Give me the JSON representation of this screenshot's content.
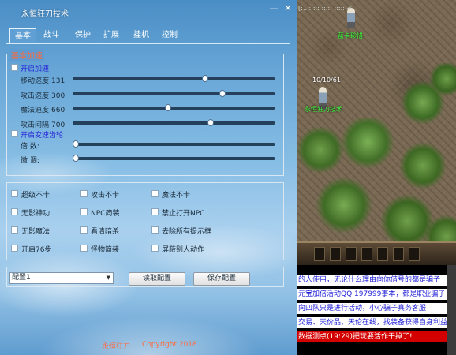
{
  "window": {
    "title": "永恒狂刀技术",
    "minimize_label": "—",
    "close_label": "✕"
  },
  "tabs": [
    {
      "label": "基本",
      "active": true
    },
    {
      "label": "战斗",
      "active": false
    },
    {
      "label": "保护",
      "active": false
    },
    {
      "label": "扩展",
      "active": false
    },
    {
      "label": "挂机",
      "active": false
    },
    {
      "label": "控制",
      "active": false
    }
  ],
  "basic_settings": {
    "group_title": "基本加速",
    "enable_speed_label": "开启加速",
    "enable_speed_checked": false,
    "sliders": [
      {
        "label": "移动速度:131",
        "value_fraction": 0.66
      },
      {
        "label": "攻击速度:300",
        "value_fraction": 0.75
      },
      {
        "label": "魔法速度:660",
        "value_fraction": 0.47
      },
      {
        "label": "攻击间隔:700",
        "value_fraction": 0.69
      }
    ],
    "enable_gear_label": "开启变速齿轮",
    "enable_gear_checked": false,
    "gear_sliders": [
      {
        "label": "倍      数:",
        "value_fraction": 0.0
      },
      {
        "label": "微      调:",
        "value_fraction": 0.0
      }
    ]
  },
  "options": [
    {
      "label": "超级不卡",
      "checked": false
    },
    {
      "label": "攻击不卡",
      "checked": false
    },
    {
      "label": "魔法不卡",
      "checked": false
    },
    {
      "label": "无影神功",
      "checked": false
    },
    {
      "label": "NPC简装",
      "checked": false
    },
    {
      "label": "禁止打开NPC",
      "checked": false
    },
    {
      "label": "无影魔法",
      "checked": false
    },
    {
      "label": "看清暗杀",
      "checked": false
    },
    {
      "label": "去除所有提示框",
      "checked": false
    },
    {
      "label": "开启76步",
      "checked": false
    },
    {
      "label": "怪物简装",
      "checked": false
    },
    {
      "label": "屏蔽别人动作",
      "checked": false
    }
  ],
  "config": {
    "selected": "配置1",
    "read_button": "读取配置",
    "save_button": "保存配置"
  },
  "footer": {
    "name": "永恒狂刀",
    "copyright": "Copyright 2018"
  },
  "game": {
    "coords": "[:1 ::::: ::::: ::::: <",
    "npc_top": "蓝卡珍惜",
    "hp_label": "10/10/61",
    "player_name": "永恒狂刀技术",
    "chat_lines": [
      {
        "text": "的人使用，无论什么理由向你借号的都是骗子",
        "style": "blue"
      },
      {
        "text": "元宝加倍活动QQ 197999事本，都是职业骗子",
        "style": "blue"
      },
      {
        "text": "向四队只是进行活动，小心骗子真务客服",
        "style": "blue"
      },
      {
        "text": "交易、天价品、天伦在线，找装备获得自身利益",
        "style": "blue"
      },
      {
        "text": "数据测点(19:29)把玩要活作干掉了!",
        "style": "red"
      }
    ]
  }
}
